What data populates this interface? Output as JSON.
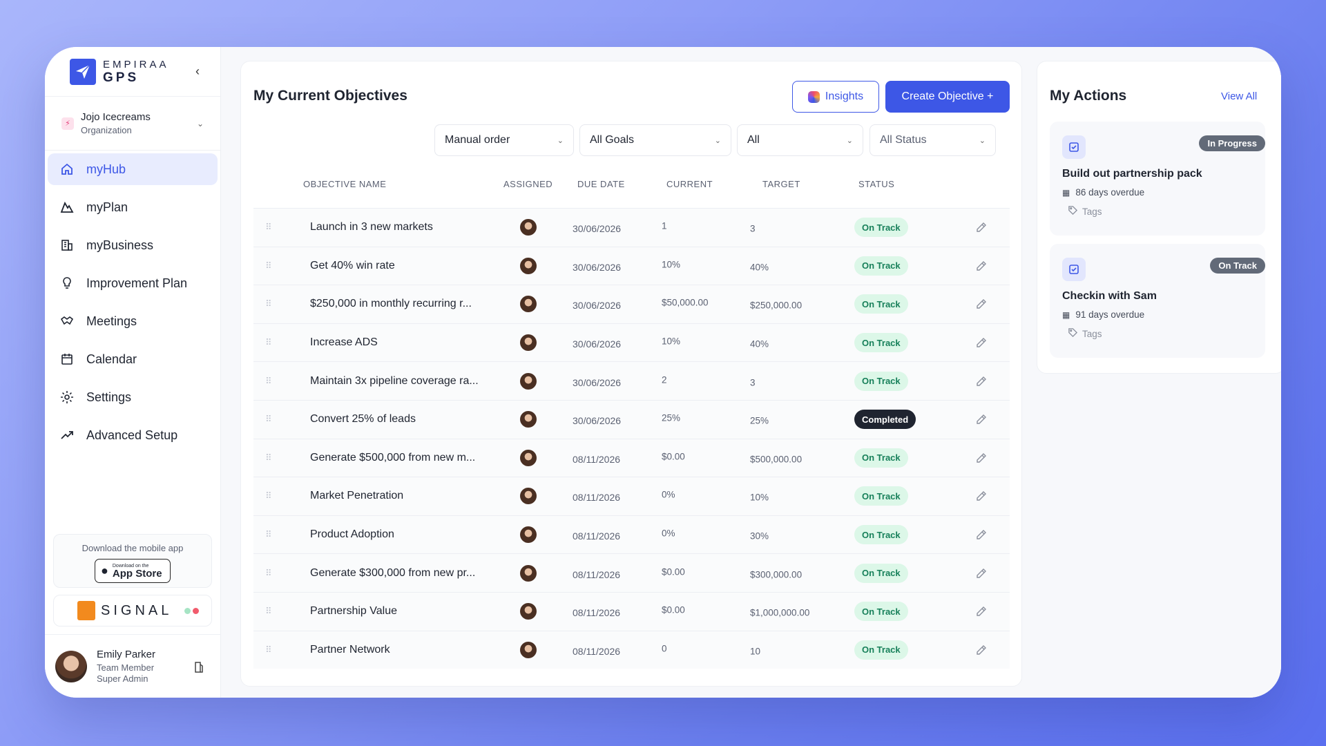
{
  "brand": {
    "line1": "EMPIRAA",
    "line2": "GPS"
  },
  "org": {
    "name": "Jojo Icecreams",
    "type": "Organization"
  },
  "nav": [
    {
      "label": "myHub",
      "icon": "home-icon",
      "active": true
    },
    {
      "label": "myPlan",
      "icon": "mountain-icon"
    },
    {
      "label": "myBusiness",
      "icon": "building-icon"
    },
    {
      "label": "Improvement Plan",
      "icon": "lightbulb-icon"
    },
    {
      "label": "Meetings",
      "icon": "handshake-icon"
    },
    {
      "label": "Calendar",
      "icon": "calendar-icon"
    },
    {
      "label": "Settings",
      "icon": "gear-icon"
    },
    {
      "label": "Advanced Setup",
      "icon": "trend-icon"
    }
  ],
  "app_download": {
    "caption": "Download the mobile app",
    "store_line1": "Download on the",
    "store_line2": "App Store"
  },
  "signal": {
    "label": "SIGNAL"
  },
  "user": {
    "name": "Emily Parker",
    "role": "Team Member",
    "role2": "Super Admin"
  },
  "objectives": {
    "title": "My Current Objectives",
    "insights_label": "Insights",
    "create_label": "Create Objective +",
    "filters": {
      "order": "Manual order",
      "goals": "All Goals",
      "scope": "All",
      "status": "All Status"
    },
    "columns": {
      "name": "OBJECTIVE NAME",
      "assigned": "ASSIGNED",
      "due": "DUE DATE",
      "current": "CURRENT",
      "target": "TARGET",
      "status": "STATUS"
    },
    "rows": [
      {
        "name": "Launch in 3 new markets",
        "due": "30/06/2026",
        "current": "1",
        "target": "3",
        "status": "On Track"
      },
      {
        "name": "Get 40% win rate",
        "due": "30/06/2026",
        "current": "10%",
        "target": "40%",
        "status": "On Track"
      },
      {
        "name": "$250,000 in monthly recurring r...",
        "due": "30/06/2026",
        "current": "$50,000.00",
        "target": "$250,000.00",
        "status": "On Track"
      },
      {
        "name": "Increase ADS",
        "due": "30/06/2026",
        "current": "10%",
        "target": "40%",
        "status": "On Track"
      },
      {
        "name": "Maintain 3x pipeline coverage ra...",
        "due": "30/06/2026",
        "current": "2",
        "target": "3",
        "status": "On Track"
      },
      {
        "name": "Convert 25% of leads",
        "due": "30/06/2026",
        "current": "25%",
        "target": "25%",
        "status": "Completed"
      },
      {
        "name": "Generate $500,000 from new m...",
        "due": "08/11/2026",
        "current": "$0.00",
        "target": "$500,000.00",
        "status": "On Track"
      },
      {
        "name": "Market Penetration",
        "due": "08/11/2026",
        "current": "0%",
        "target": "10%",
        "status": "On Track"
      },
      {
        "name": "Product Adoption",
        "due": "08/11/2026",
        "current": "0%",
        "target": "30%",
        "status": "On Track"
      },
      {
        "name": "Generate $300,000 from new pr...",
        "due": "08/11/2026",
        "current": "$0.00",
        "target": "$300,000.00",
        "status": "On Track"
      },
      {
        "name": "Partnership Value",
        "due": "08/11/2026",
        "current": "$0.00",
        "target": "$1,000,000.00",
        "status": "On Track"
      },
      {
        "name": "Partner Network",
        "due": "08/11/2026",
        "current": "0",
        "target": "10",
        "status": "On Track"
      }
    ]
  },
  "actions": {
    "title": "My Actions",
    "view_all": "View All",
    "items": [
      {
        "status": "In Progress",
        "title": "Build out partnership pack",
        "overdue": "86 days overdue",
        "tags": "Tags"
      },
      {
        "status": "On Track",
        "title": "Checkin with Sam",
        "overdue": "91 days overdue",
        "tags": "Tags"
      }
    ]
  },
  "colors": {
    "accent": "#3d57e6",
    "on_track_bg": "#dcf7e8",
    "on_track_text": "#17805a",
    "completed_bg": "#1f2430"
  }
}
